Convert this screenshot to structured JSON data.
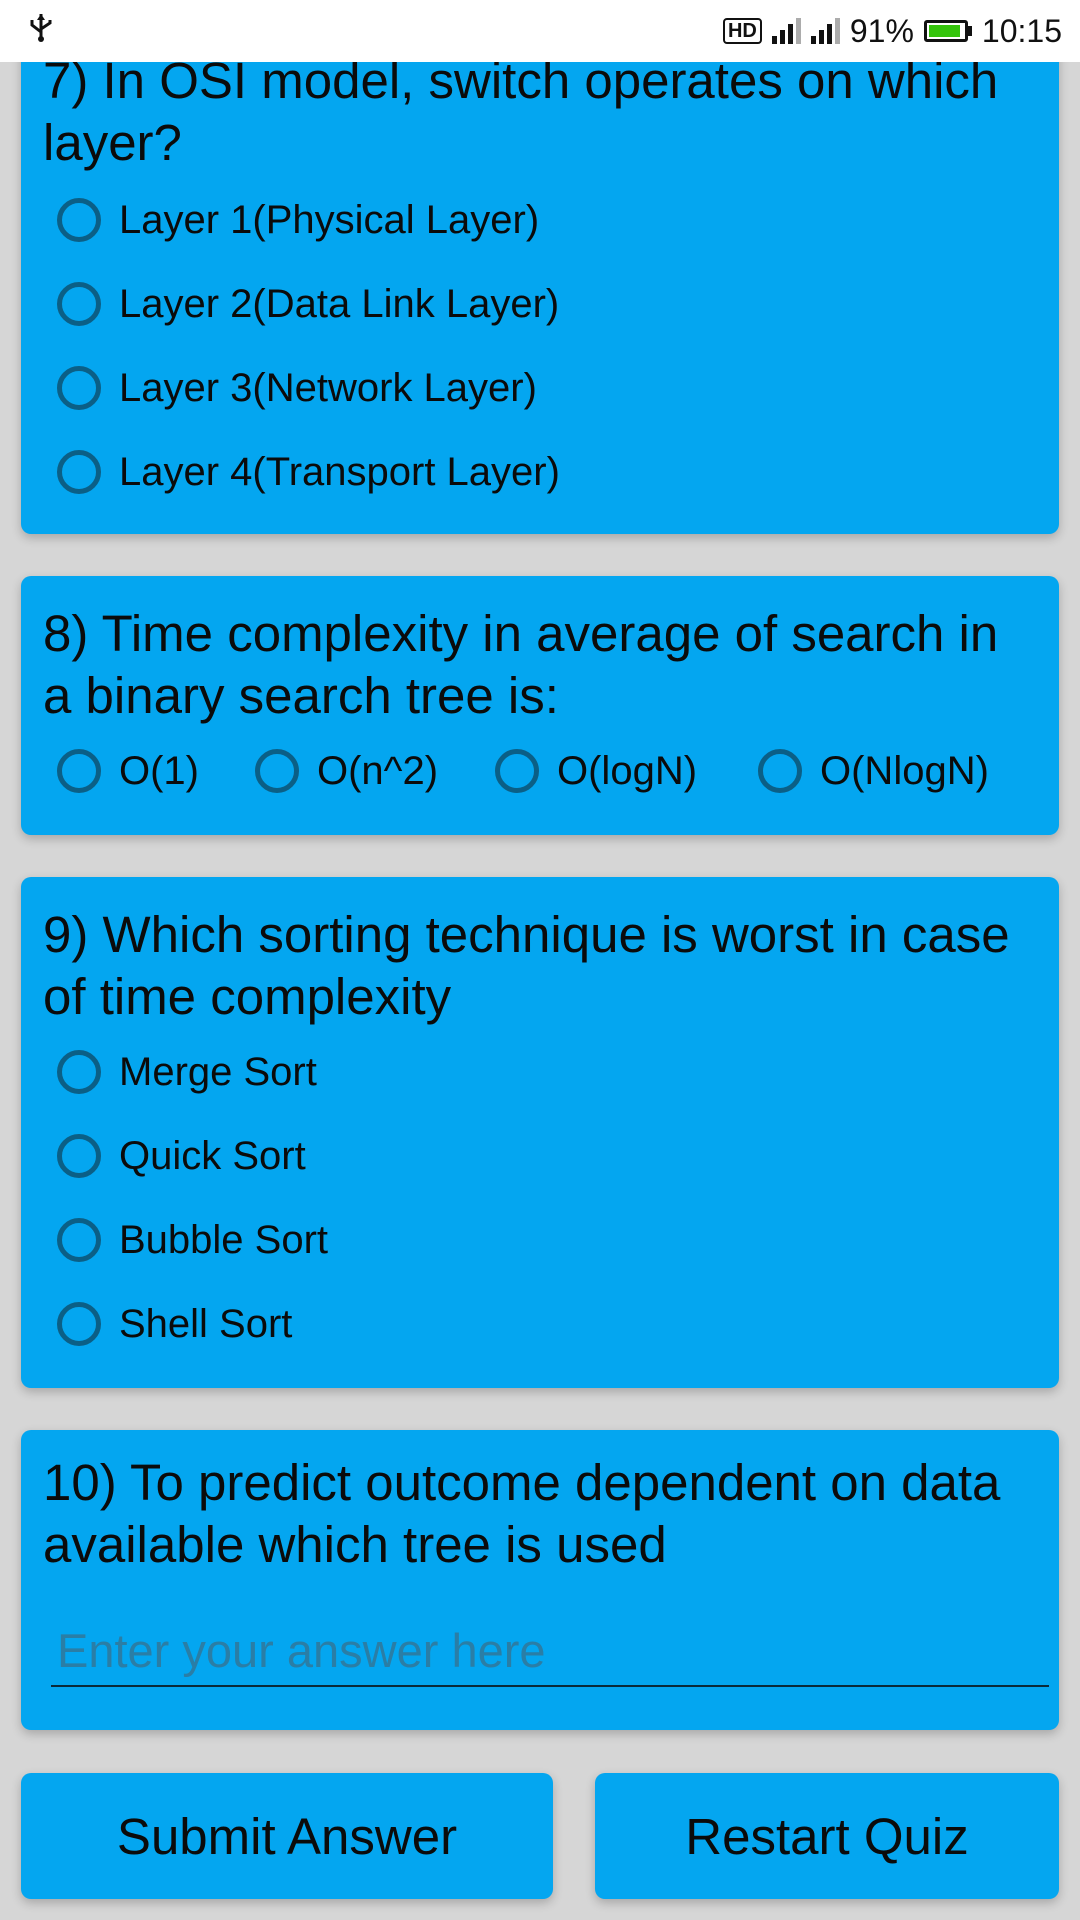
{
  "status_bar": {
    "left_icon": "usb-icon",
    "hd": "HD",
    "battery_percent": "91%",
    "battery_level": 0.91,
    "time": "10:15"
  },
  "questions": [
    {
      "text": "7) In OSI model, switch operates on which layer?",
      "options": [
        "Layer 1(Physical Layer)",
        "Layer 2(Data Link Layer)",
        "Layer 3(Network Layer)",
        "Layer 4(Transport Layer)"
      ]
    },
    {
      "text": "8) Time complexity in average of search in a binary search tree is:",
      "options": [
        "O(1)",
        "O(n^2)",
        "O(logN)",
        "O(NlogN)"
      ]
    },
    {
      "text": "9) Which sorting technique is worst in case of time complexity",
      "options": [
        "Merge Sort",
        "Quick Sort",
        "Bubble Sort",
        "Shell Sort"
      ]
    },
    {
      "text": "10) To predict outcome dependent on data available which tree is used",
      "answer_placeholder": "Enter your answer here",
      "answer_value": ""
    }
  ],
  "buttons": {
    "submit": "Submit Answer",
    "restart": "Restart Quiz"
  },
  "colors": {
    "card": "#04a6f0",
    "background": "#d6d6d6",
    "radio_border": "#0b5f86",
    "battery_fill": "#34c40a"
  }
}
